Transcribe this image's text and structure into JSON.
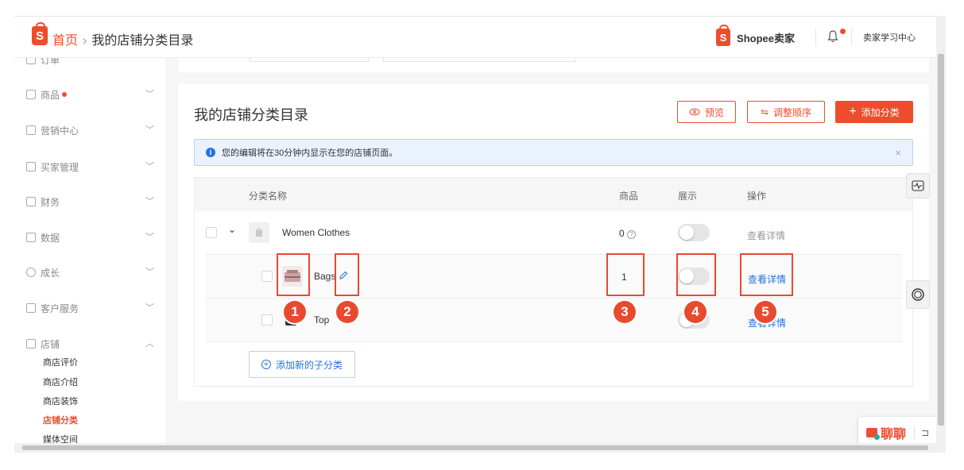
{
  "header": {
    "home_label": "首页",
    "separator": "›",
    "current_page": "我的店铺分类目录",
    "brand_label": "Shopee卖家",
    "learning_center": "卖家学习中心",
    "logo_letter": "S"
  },
  "sidebar": {
    "items": [
      {
        "label": "订单",
        "icon": "order-icon"
      },
      {
        "label": "商品",
        "icon": "product-icon",
        "badge": true
      },
      {
        "label": "营销中心",
        "icon": "marketing-icon"
      },
      {
        "label": "买家管理",
        "icon": "buyer-icon"
      },
      {
        "label": "财务",
        "icon": "finance-icon"
      },
      {
        "label": "数据",
        "icon": "data-icon"
      },
      {
        "label": "成长",
        "icon": "growth-icon"
      },
      {
        "label": "客户服务",
        "icon": "service-icon"
      },
      {
        "label": "店铺",
        "icon": "shop-icon"
      }
    ],
    "shop_sub_items": [
      "商店评价",
      "商店介绍",
      "商店装饰",
      "店铺分类",
      "媒体空间"
    ],
    "active_sub_item": "店铺分类"
  },
  "main": {
    "title": "我的店铺分类目录",
    "buttons": {
      "preview": "预览",
      "reorder": "调整顺序",
      "add_category": "添加分类"
    },
    "notice": "您的编辑将在30分钟内显示在您的店铺页面。",
    "table": {
      "headers": {
        "name": "分类名称",
        "products": "商品",
        "display": "展示",
        "actions": "操作"
      },
      "rows": [
        {
          "name": "Women Clothes",
          "products": "0",
          "display": false,
          "action": "查看详情",
          "level": "parent"
        },
        {
          "name": "Bags",
          "products": "1",
          "display": false,
          "action": "查看详情",
          "level": "child"
        },
        {
          "name": "Top",
          "products": "",
          "display": false,
          "action": "查看详情",
          "level": "child"
        }
      ],
      "add_subcategory": "添加新的子分类"
    }
  },
  "annotations": [
    "1",
    "2",
    "3",
    "4",
    "5"
  ],
  "chat": {
    "label": "聊聊"
  },
  "colors": {
    "accent": "#ee4d2d",
    "link": "#2673dd",
    "annotation": "#e84a2f"
  }
}
